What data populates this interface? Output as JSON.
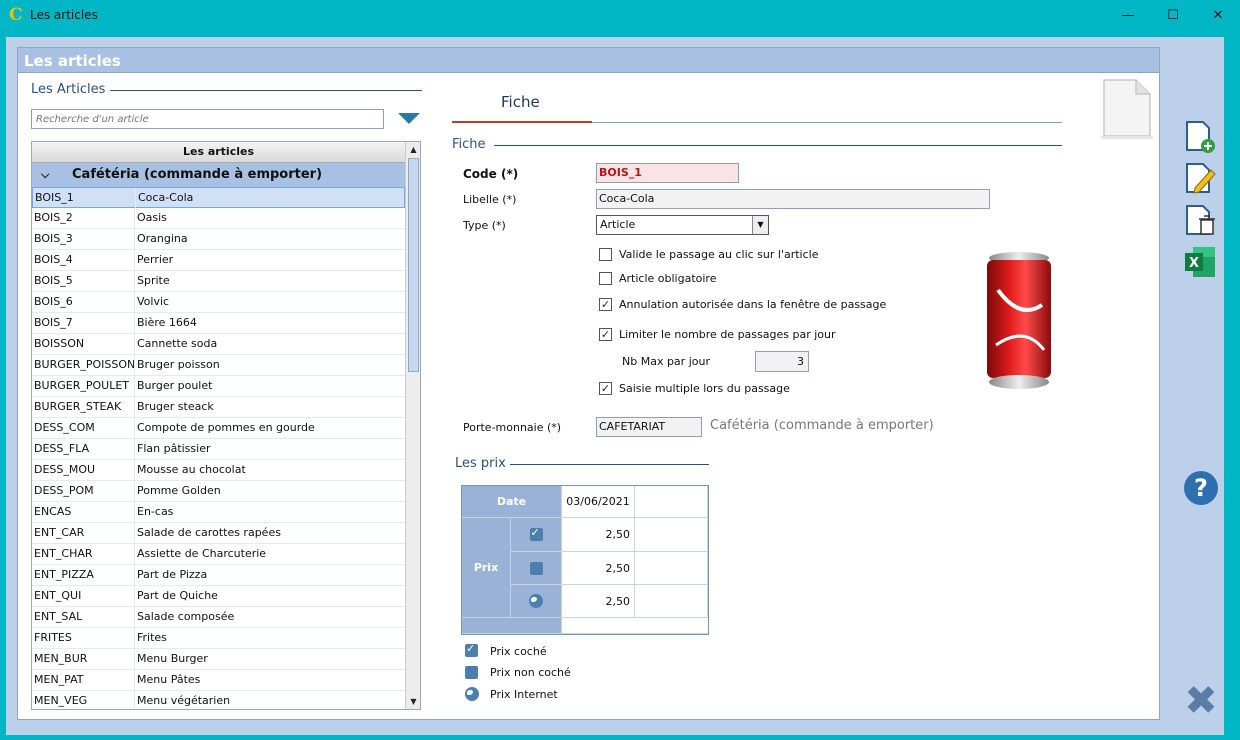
{
  "window": {
    "title": "Les articles"
  },
  "panel": {
    "title": "Les articles"
  },
  "articles": {
    "group_title": "Les Articles",
    "search_placeholder": "Recherche d'un article",
    "table_header": "Les articles",
    "group_row": "Cafétéria (commande à emporter)",
    "rows": [
      [
        "BOIS_1",
        "Coca-Cola"
      ],
      [
        "BOIS_2",
        "Oasis"
      ],
      [
        "BOIS_3",
        "Orangina"
      ],
      [
        "BOIS_4",
        "Perrier"
      ],
      [
        "BOIS_5",
        "Sprite"
      ],
      [
        "BOIS_6",
        "Volvic"
      ],
      [
        "BOIS_7",
        "Bière 1664"
      ],
      [
        "BOISSON",
        "Cannette soda"
      ],
      [
        "BURGER_POISSON",
        "Bruger poisson"
      ],
      [
        "BURGER_POULET",
        "Burger poulet"
      ],
      [
        "BURGER_STEAK",
        "Bruger steack"
      ],
      [
        "DESS_COM",
        "Compote de pommes en gourde"
      ],
      [
        "DESS_FLA",
        "Flan pâtissier"
      ],
      [
        "DESS_MOU",
        "Mousse au chocolat"
      ],
      [
        "DESS_POM",
        "Pomme Golden"
      ],
      [
        "ENCAS",
        "En-cas"
      ],
      [
        "ENT_CAR",
        "Salade de carottes rapées"
      ],
      [
        "ENT_CHAR",
        "Assiette de Charcuterie"
      ],
      [
        "ENT_PIZZA",
        "Part de Pizza"
      ],
      [
        "ENT_QUI",
        "Part de Quiche"
      ],
      [
        "ENT_SAL",
        "Salade composée"
      ],
      [
        "FRITES",
        "Frites"
      ],
      [
        "MEN_BUR",
        "Menu Burger"
      ],
      [
        "MEN_PAT",
        "Menu Pâtes"
      ],
      [
        "MEN_VEG",
        "Menu végétarien"
      ]
    ],
    "selected_index": 0
  },
  "fiche": {
    "tab_label": "Fiche",
    "group_title": "Fiche",
    "code_label": "Code (*)",
    "code_value": "BOIS_1",
    "libelle_label": "Libelle (*)",
    "libelle_value": "Coca-Cola",
    "type_label": "Type (*)",
    "type_value": "Article",
    "checkboxes": [
      {
        "label": "Valide le passage au clic sur l'article",
        "checked": false
      },
      {
        "label": "Article obligatoire",
        "checked": false
      },
      {
        "label": "Annulation autorisée dans la fenêtre de passage",
        "checked": true
      },
      {
        "label": "Limiter le nombre de passages par jour",
        "checked": true
      },
      {
        "label": "Saisie multiple lors du passage",
        "checked": true
      }
    ],
    "nbmax_label": "Nb Max par jour",
    "nbmax_value": "3",
    "portemonnaie_label": "Porte-monnaie (*)",
    "portemonnaie_value": "CAFETARIAT",
    "portemonnaie_text": "Cafétéria (commande à emporter)"
  },
  "prix": {
    "group_title": "Les prix",
    "date_label": "Date",
    "date_value": "03/06/2021",
    "prix_label": "Prix",
    "rows": [
      {
        "icon": "checked-square-icon",
        "value": "2,50"
      },
      {
        "icon": "square-icon",
        "value": "2,50"
      },
      {
        "icon": "globe-icon",
        "value": "2,50"
      }
    ],
    "legend": [
      {
        "icon": "checked-square-icon",
        "label": "Prix coché"
      },
      {
        "icon": "square-icon",
        "label": "Prix non coché"
      },
      {
        "icon": "globe-icon",
        "label": "Prix Internet"
      }
    ]
  },
  "toolbar": {
    "help_glyph": "?",
    "close_glyph": "✖"
  },
  "colors": {
    "titlebar": "#00b6c4",
    "panel_header": "#a8c0e2",
    "accent": "#2b4f7a",
    "selected_row": "#cfe0f7"
  }
}
